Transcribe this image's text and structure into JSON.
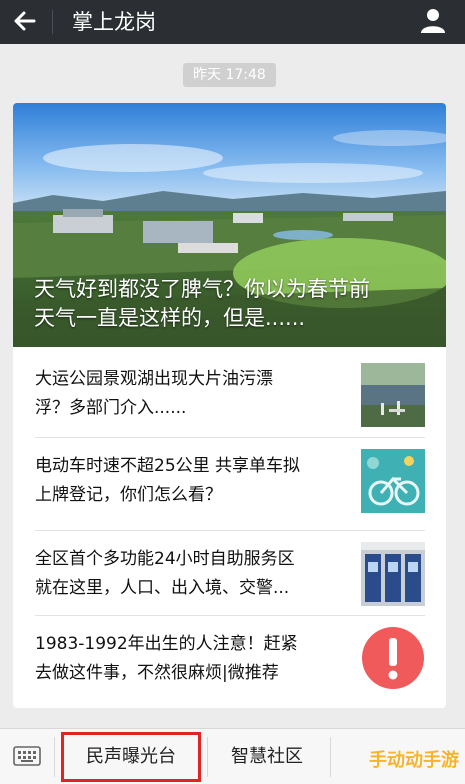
{
  "header": {
    "title": "掌上龙岗",
    "back_icon": "arrow-left-icon",
    "profile_icon": "person-icon"
  },
  "timestamp": "昨天 17:48",
  "hero": {
    "title_line1": "天气好到都没了脾气？你以为春节前",
    "title_line2": "天气一直是这样的，但是......"
  },
  "articles": [
    {
      "line1": "大运公园景观湖出现大片油污漂",
      "line2": "浮？多部门介入......",
      "thumb": "lake-photo"
    },
    {
      "line1": "电动车时速不超25公里 共享单车拟",
      "line2": "上牌登记，你们怎么看？",
      "thumb": "bicycle-photo"
    },
    {
      "line1": "全区首个多功能24小时自助服务区",
      "line2": "就在这里，人口、出入境、交警...",
      "thumb": "kiosk-photo"
    },
    {
      "line1": "1983-1992年出生的人注意！赶紧",
      "line2": "去做这件事，不然很麻烦|微推荐",
      "thumb": "exclamation-icon"
    }
  ],
  "bottom_menu": {
    "keyboard_icon": "keyboard-icon",
    "item1": "民声曝光台",
    "item2": "智慧社区"
  },
  "watermark": "手动动手游",
  "colors": {
    "topbar": "#2b2f33",
    "highlight": "#e32222",
    "alert": "#f15a5a"
  }
}
